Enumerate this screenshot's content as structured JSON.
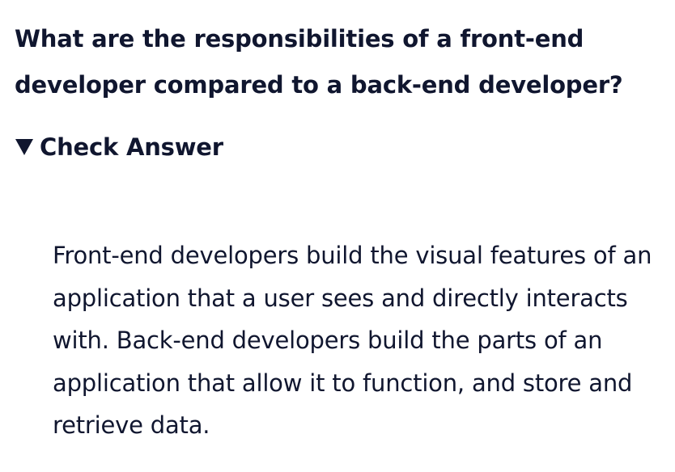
{
  "question": {
    "text": "What are the responsibilities of a front-end developer compared to a back-end developer?"
  },
  "details": {
    "summary_label": "Check Answer",
    "expanded_icon": "triangle-down-icon",
    "answer": "Front-end developers build the visual features of an application that a user sees and directly interacts with. Back-end developers build the parts of an application that allow it to function, and store and retrieve data."
  },
  "colors": {
    "text": "#10162f",
    "background": "#ffffff"
  }
}
